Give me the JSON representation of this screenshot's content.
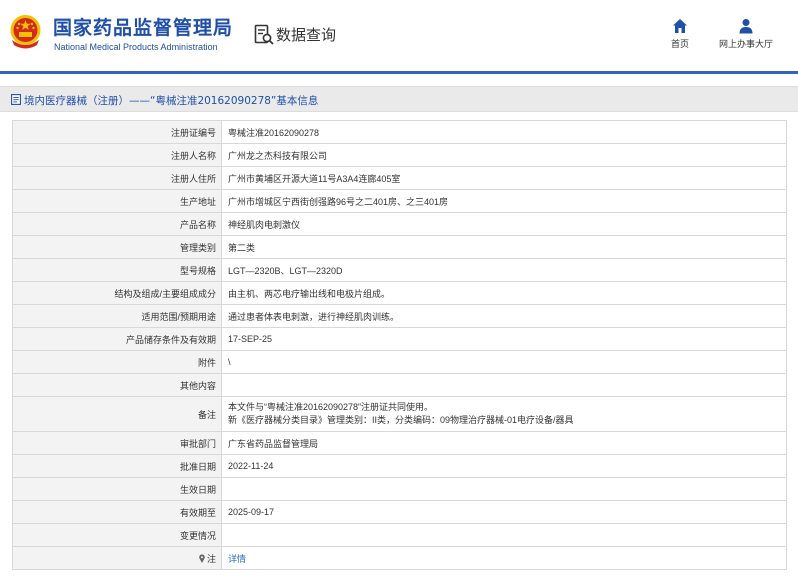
{
  "header": {
    "title": "国家药品监督管理局",
    "subtitle": "National Medical Products Administration",
    "query_label": "数据查询",
    "nav": [
      {
        "label": "首页",
        "icon": "home-icon"
      },
      {
        "label": "网上办事大厅",
        "icon": "user-icon"
      }
    ]
  },
  "breadcrumb": {
    "text": "境内医疗器械（注册）——“粤械注准20162090278”基本信息"
  },
  "table": {
    "rows": [
      {
        "label": "注册证编号",
        "value": "粤械注准20162090278"
      },
      {
        "label": "注册人名称",
        "value": "广州龙之杰科技有限公司"
      },
      {
        "label": "注册人住所",
        "value": "广州市黄埔区开源大道11号A3A4连廊405室"
      },
      {
        "label": "生产地址",
        "value": "广州市增城区宁西街创强路96号之二401房、之三401房"
      },
      {
        "label": "产品名称",
        "value": "神经肌肉电刺激仪"
      },
      {
        "label": "管理类别",
        "value": "第二类"
      },
      {
        "label": "型号规格",
        "value": "LGT—2320B、LGT—2320D"
      },
      {
        "label": "结构及组成/主要组成成分",
        "value": "由主机、两芯电疗输出线和电极片组成。"
      },
      {
        "label": "适用范围/预期用途",
        "value": "通过患者体表电刺激，进行神经肌肉训练。"
      },
      {
        "label": "产品储存条件及有效期",
        "value": "17-SEP-25"
      },
      {
        "label": "附件",
        "value": "\\"
      },
      {
        "label": "其他内容",
        "value": ""
      },
      {
        "label": "备注",
        "lines": [
          "本文件与“粤械注准20162090278”注册证共同使用。",
          "新《医疗器械分类目录》管理类别：II类，分类编码：09物理治疗器械-01电疗设备/器具"
        ]
      },
      {
        "label": "审批部门",
        "value": "广东省药品监督管理局"
      },
      {
        "label": "批准日期",
        "value": "2022-11-24"
      },
      {
        "label": "生效日期",
        "value": ""
      },
      {
        "label": "有效期至",
        "value": "2025-09-17"
      },
      {
        "label": "变更情况",
        "value": ""
      },
      {
        "label": "注",
        "value": "详情",
        "link": true
      }
    ]
  },
  "colors": {
    "brand_blue": "#1f4fa8",
    "header_line": "#2f65c0",
    "link": "#2a6cc6",
    "label_bg": "#f3f3f3",
    "emblem_red": "#d42a1d",
    "emblem_gold": "#f2c200"
  }
}
